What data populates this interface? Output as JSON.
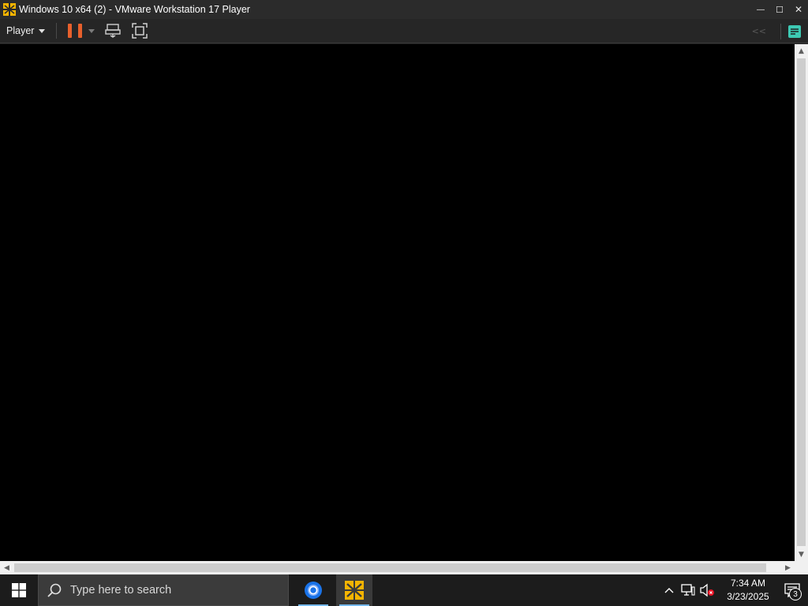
{
  "window": {
    "title": "Windows 10 x64 (2) - VMware Workstation 17 Player",
    "controls": {
      "minimize": "—",
      "maximize": "☐",
      "close": "✕"
    }
  },
  "toolbar": {
    "player_menu_label": "Player",
    "accent_color": "#e8602c"
  },
  "taskbar": {
    "search_placeholder": "Type here to search",
    "apps": [
      {
        "name": "chrome-icon",
        "active": false
      },
      {
        "name": "vmware-player-icon",
        "active": true
      }
    ],
    "clock": {
      "time": "7:34 AM",
      "date": "3/23/2025"
    },
    "notification_count": "3"
  }
}
